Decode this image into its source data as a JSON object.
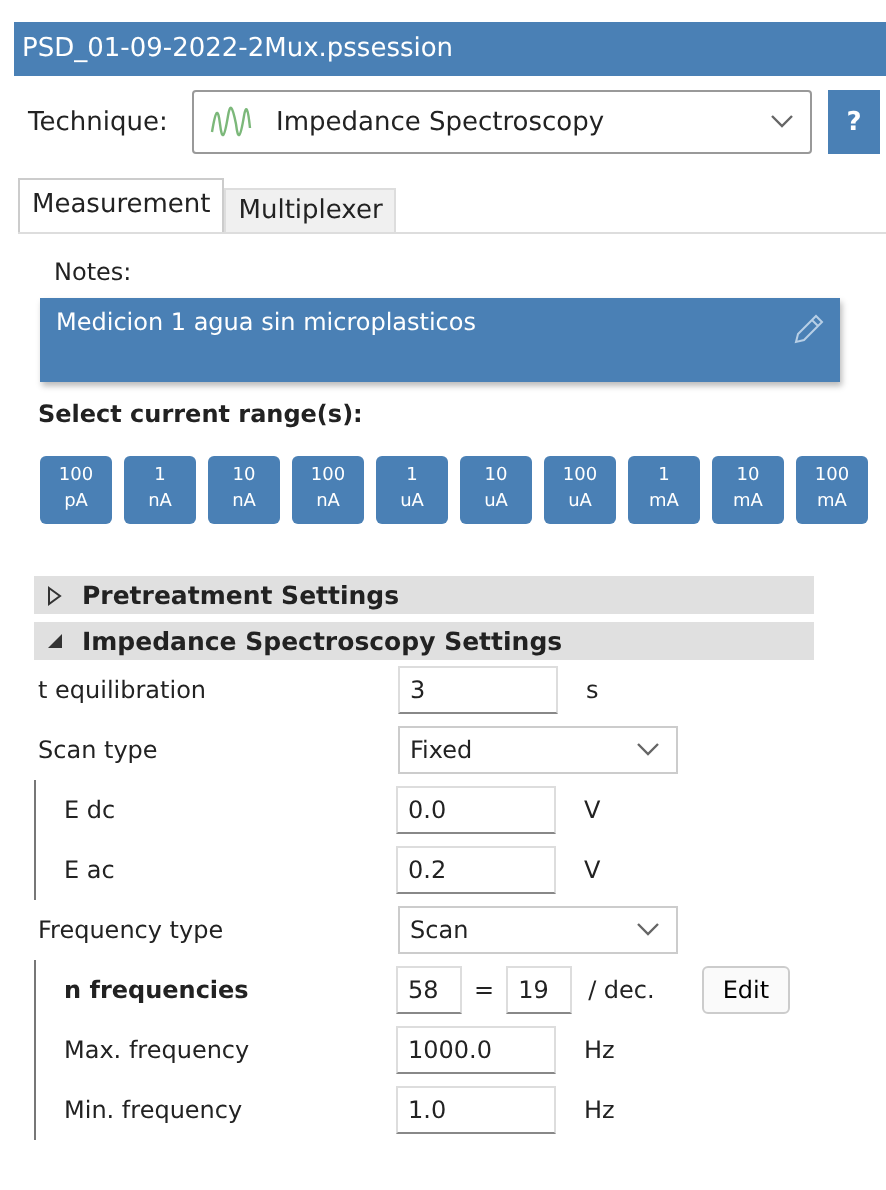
{
  "window": {
    "title": "PSD_01-09-2022-2Mux.pssession"
  },
  "technique": {
    "label": "Technique:",
    "value": "Impedance Spectroscopy",
    "help": "?"
  },
  "tabs": [
    {
      "label": "Measurement",
      "selected": true
    },
    {
      "label": "Multiplexer",
      "selected": false
    }
  ],
  "notes": {
    "label": "Notes:",
    "value": "Medicion 1 agua sin microplasticos"
  },
  "current_ranges": {
    "label": "Select current range(s):",
    "items": [
      {
        "value": "100",
        "unit": "pA",
        "selected": true
      },
      {
        "value": "1",
        "unit": "nA",
        "selected": true
      },
      {
        "value": "10",
        "unit": "nA",
        "selected": true
      },
      {
        "value": "100",
        "unit": "nA",
        "selected": true
      },
      {
        "value": "1",
        "unit": "uA",
        "selected": true
      },
      {
        "value": "10",
        "unit": "uA",
        "selected": true
      },
      {
        "value": "100",
        "unit": "uA",
        "selected": true
      },
      {
        "value": "1",
        "unit": "mA",
        "selected": true
      },
      {
        "value": "10",
        "unit": "mA",
        "selected": true
      },
      {
        "value": "100",
        "unit": "mA",
        "selected": true
      }
    ]
  },
  "sections": [
    {
      "title": "Pretreatment Settings",
      "expanded": false
    },
    {
      "title": "Impedance Spectroscopy Settings",
      "expanded": true
    }
  ],
  "params": [
    {
      "kind": "input",
      "label": "t equilibration",
      "value": "3",
      "unit": "s"
    },
    {
      "kind": "select",
      "label": "Scan type",
      "value": "Fixed"
    },
    {
      "kind": "group",
      "rows": [
        {
          "kind": "input",
          "label": "E dc",
          "value": "0.0",
          "unit": "V"
        },
        {
          "kind": "input",
          "label": "E ac",
          "value": "0.2",
          "unit": "V"
        }
      ]
    },
    {
      "kind": "select",
      "label": "Frequency type",
      "value": "Scan"
    },
    {
      "kind": "group",
      "rows": [
        {
          "kind": "nfreq",
          "label": "n frequencies",
          "value": "58",
          "equals": "=",
          "per_decade": "19",
          "unit": "/ dec.",
          "button": "Edit"
        },
        {
          "kind": "input",
          "label": "Max. frequency",
          "value": "1000.0",
          "unit": "Hz"
        },
        {
          "kind": "input",
          "label": "Min. frequency",
          "value": "1.0",
          "unit": "Hz"
        }
      ]
    }
  ]
}
